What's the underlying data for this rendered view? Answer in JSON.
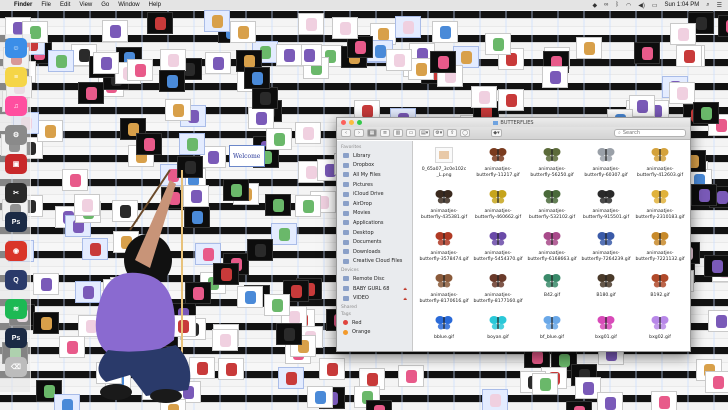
{
  "menubar": {
    "app": "Finder",
    "menus": [
      "File",
      "Edit",
      "View",
      "Go",
      "Window",
      "Help"
    ],
    "clock": "Sun 1:04 PM"
  },
  "finder": {
    "title": "BUTTERFLIES",
    "search_placeholder": "Search",
    "sidebar": {
      "favorites_header": "Favorites",
      "favorites": [
        {
          "label": "Library",
          "icon": "folder-icon"
        },
        {
          "label": "Dropbox",
          "icon": "dropbox-icon"
        },
        {
          "label": "All My Files",
          "icon": "all-files-icon"
        },
        {
          "label": "Pictures",
          "icon": "pictures-icon"
        },
        {
          "label": "iCloud Drive",
          "icon": "cloud-icon"
        },
        {
          "label": "AirDrop",
          "icon": "airdrop-icon"
        },
        {
          "label": "Movies",
          "icon": "movies-icon"
        },
        {
          "label": "Applications",
          "icon": "applications-icon"
        },
        {
          "label": "Desktop",
          "icon": "desktop-icon"
        },
        {
          "label": "Documents",
          "icon": "documents-icon"
        },
        {
          "label": "Downloads",
          "icon": "downloads-icon"
        },
        {
          "label": "Creative Cloud Files",
          "icon": "creative-cloud-icon"
        }
      ],
      "devices_header": "Devices",
      "devices": [
        {
          "label": "Remote Disc",
          "icon": "disc-icon"
        },
        {
          "label": "BABY GURL 68",
          "icon": "drive-icon"
        },
        {
          "label": "VIDEO",
          "icon": "drive-icon"
        }
      ],
      "shared_header": "Shared",
      "tags_header": "Tags",
      "tags": [
        {
          "label": "Red",
          "color": "#e0443e"
        },
        {
          "label": "Orange",
          "color": "#f39a2b"
        }
      ]
    },
    "files": [
      {
        "name": "0_65a07_3c0e102c\n_L.png",
        "thumb": "#e8c9a8"
      },
      {
        "name": "animaatjes-\nbutterfly-11217.gif",
        "thumb": "#7a3b1e"
      },
      {
        "name": "animaatjes-\nbutterfly-56250.gif",
        "thumb": "#5c6b3a"
      },
      {
        "name": "animaatjes-\nbutterfly-60307.gif",
        "thumb": "#9aa0a8"
      },
      {
        "name": "animaatjes-\nbutterfly-412603.gif",
        "thumb": "#d4a23c"
      },
      {
        "name": "animaatjes-\nbutterfly-435381.gif",
        "thumb": "#3a2a1e"
      },
      {
        "name": "animaatjes-\nbutterfly-460662.gif",
        "thumb": "#c6a41c"
      },
      {
        "name": "animaatjes-\nbutterfly-532102.gif",
        "thumb": "#4a6a3a"
      },
      {
        "name": "animaatjes-\nbutterfly-915501.gif",
        "thumb": "#2a2a2a"
      },
      {
        "name": "animaatjes-\nbutterfly-2310183.gif",
        "thumb": "#e0b23c"
      },
      {
        "name": "animaatjes-\nbutterfly-3578474.gif",
        "thumb": "#b03a24"
      },
      {
        "name": "animaatjes-\nbutterfly-5454370.gif",
        "thumb": "#6a4aa8"
      },
      {
        "name": "animaatjes-\nbutterfly-6168663.gif",
        "thumb": "#a84a8a"
      },
      {
        "name": "animaatjes-\nbutterfly-7264239.gif",
        "thumb": "#3a5aa8"
      },
      {
        "name": "animaatjes-\nbutterfly-7221132.gif",
        "thumb": "#c88a2a"
      },
      {
        "name": "animaatjes-\nbutterfly-8170616.gif",
        "thumb": "#8a5a3a"
      },
      {
        "name": "animaatjes-\nbutterfly-8177160.gif",
        "thumb": "#6a3a2a"
      },
      {
        "name": "B42.gif",
        "thumb": "#3a8a6a"
      },
      {
        "name": "B180.gif",
        "thumb": "#4a3a2a"
      },
      {
        "name": "B192.gif",
        "thumb": "#b04a2a"
      },
      {
        "name": "bblue.gif",
        "thumb": "#2a6ad8"
      },
      {
        "name": "boyan.gif",
        "thumb": "#2ac8d8"
      },
      {
        "name": "bf_blue.gif",
        "thumb": "#6aa8e8"
      },
      {
        "name": "bxg01.gif",
        "thumb": "#d84ab8"
      },
      {
        "name": "bxg02.gif",
        "thumb": "#b888e8"
      }
    ]
  },
  "desktop": {
    "sticker_text": "Welcome"
  },
  "dock": {
    "apps": [
      {
        "name": "Finder",
        "color": "#3b8ee8",
        "glyph": "☺"
      },
      {
        "name": "Notes",
        "color": "#f5d547",
        "glyph": "≡"
      },
      {
        "name": "iTunes",
        "color": "#ff4fa0",
        "glyph": "♫"
      },
      {
        "name": "System Preferences",
        "color": "#8a8a8a",
        "glyph": "⚙"
      },
      {
        "name": "Photo Booth",
        "color": "#c8282a",
        "glyph": "▣"
      },
      {
        "name": "Final Cut",
        "color": "#2a2a2a",
        "glyph": "✂"
      },
      {
        "name": "Photoshop",
        "color": "#1b2a44",
        "glyph": "Ps"
      },
      {
        "name": "Chrome",
        "color": "#d9352a",
        "glyph": "◉"
      },
      {
        "name": "QuickTime",
        "color": "#2a3a6a",
        "glyph": "Q"
      },
      {
        "name": "Spotify",
        "color": "#1db954",
        "glyph": "≋"
      },
      {
        "name": "Photoshop",
        "color": "#1b2a44",
        "glyph": "Ps"
      },
      {
        "name": "Trash",
        "color": "#bcbcbc",
        "glyph": "⌫"
      }
    ]
  }
}
